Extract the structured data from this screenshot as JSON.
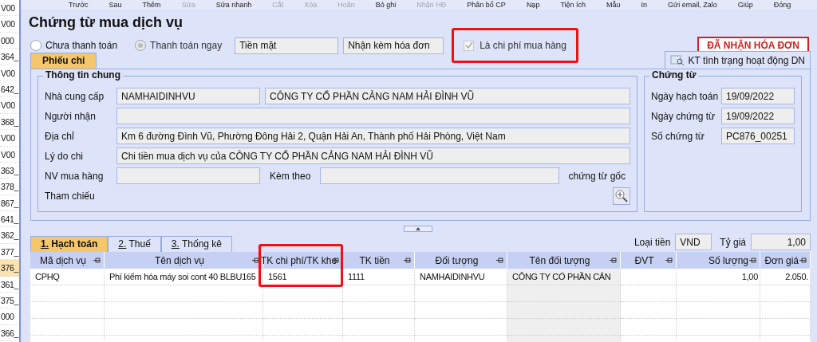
{
  "side_list": {
    "items": [
      {
        "label": "V00",
        "selected": false
      },
      {
        "label": "V00",
        "selected": false
      },
      {
        "label": "000",
        "selected": false
      },
      {
        "label": "364_",
        "selected": false
      },
      {
        "label": "V00",
        "selected": false
      },
      {
        "label": "642_",
        "selected": false
      },
      {
        "label": "V00",
        "selected": false
      },
      {
        "label": "368_",
        "selected": false
      },
      {
        "label": "V00",
        "selected": false
      },
      {
        "label": "V00",
        "selected": false
      },
      {
        "label": "363_",
        "selected": false
      },
      {
        "label": "378_",
        "selected": false
      },
      {
        "label": "867_",
        "selected": false
      },
      {
        "label": "641_",
        "selected": false
      },
      {
        "label": "362_",
        "selected": false
      },
      {
        "label": "377_",
        "selected": false
      },
      {
        "label": "376_",
        "selected": true
      },
      {
        "label": "361_",
        "selected": false
      },
      {
        "label": "375_",
        "selected": false
      },
      {
        "label": "000",
        "selected": false
      },
      {
        "label": "366_",
        "selected": false
      }
    ]
  },
  "toolbar": [
    {
      "label": "Trước",
      "disabled": false
    },
    {
      "label": "Sau",
      "disabled": false
    },
    {
      "label": "Thêm",
      "disabled": false
    },
    {
      "label": "Sửa",
      "disabled": true
    },
    {
      "label": "Sửa nhanh",
      "disabled": false
    },
    {
      "label": "Cắt",
      "disabled": true
    },
    {
      "label": "Xóa",
      "disabled": true
    },
    {
      "label": "Hoãn",
      "disabled": true
    },
    {
      "label": "Bỏ ghi",
      "disabled": false
    },
    {
      "label": "Nhận HĐ",
      "disabled": true
    },
    {
      "label": "Phân bổ CP",
      "disabled": false
    },
    {
      "label": "Nạp",
      "disabled": false
    },
    {
      "label": "Tiện ích",
      "disabled": false
    },
    {
      "label": "Mẫu",
      "disabled": false
    },
    {
      "label": "In",
      "disabled": false
    },
    {
      "label": "Gửi email, Zalo",
      "disabled": false
    },
    {
      "label": "Giúp",
      "disabled": false
    },
    {
      "label": "Đóng",
      "disabled": false
    }
  ],
  "window": {
    "title": "Chứng từ mua dịch vụ"
  },
  "payment": {
    "options": [
      {
        "label": "Chưa thanh toán",
        "selected": false,
        "disabled": false
      },
      {
        "label": "Thanh toán ngay",
        "selected": true,
        "disabled": true
      }
    ],
    "method": "Tiền mặt",
    "invoice": "Nhận kèm hóa đơn",
    "purchase_cost": {
      "label": "Là chi phí mua hàng",
      "checked": true,
      "disabled": true,
      "highlighted": true
    },
    "stamp": "ĐÃ NHẬN HÓA ĐƠN"
  },
  "form_tabs": [
    {
      "label": "Phiếu chi",
      "selected": true
    }
  ],
  "check_button": "KT tình trạng hoạt động DN",
  "general": {
    "title": "Thông tin chung",
    "supplier": {
      "label": "Nhà cung cấp",
      "code": "NAMHAIDINHVU",
      "name": "CÔNG TY CỔ PHẦN CẢNG NAM HẢI ĐÌNH VŨ"
    },
    "receiver": {
      "label": "Người nhận"
    },
    "address": {
      "label": "Địa chỉ",
      "value": "Km 6 đường Đình Vũ, Phường Đông Hải 2, Quận Hải An, Thành phố Hải Phòng, Việt Nam"
    },
    "reason": {
      "label": "Lý do chi",
      "value": "Chi tiền mua dịch vụ của CÔNG TY CỔ PHẦN CẢNG NAM HẢI ĐÌNH VŨ"
    },
    "buyer": {
      "label": "NV mua hàng"
    },
    "attached": {
      "label": "Kèm theo",
      "suffix": "chứng từ gốc"
    },
    "reference": {
      "label": "Tham chiếu"
    }
  },
  "voucher": {
    "title": "Chứng từ",
    "rows": [
      {
        "label": "Ngày hạch toán",
        "value": "19/09/2022"
      },
      {
        "label": "Ngày chứng từ",
        "value": "19/09/2022"
      },
      {
        "label": "Số chứng từ",
        "value": "PC876_00251"
      }
    ]
  },
  "detail_tabs": [
    {
      "label": "1. Hạch toán",
      "selected": true
    },
    {
      "label": "2. Thuế",
      "selected": false
    },
    {
      "label": "3. Thống kê",
      "selected": false
    }
  ],
  "currency": {
    "label": "Loại tiền",
    "value": "VND",
    "rate_label": "Tỷ giá",
    "rate": "1,00"
  },
  "table": {
    "columns": [
      {
        "label": "Mã dịch vụ",
        "kind": "text",
        "readonly": false,
        "highlighted": false
      },
      {
        "label": "Tên dịch vụ",
        "kind": "text",
        "readonly": false,
        "highlighted": false
      },
      {
        "label": "TK chi phí/TK kho",
        "kind": "text",
        "readonly": false,
        "highlighted": true
      },
      {
        "label": "TK tiền",
        "kind": "text",
        "readonly": false,
        "highlighted": false
      },
      {
        "label": "Đối tượng",
        "kind": "text",
        "readonly": false,
        "highlighted": false
      },
      {
        "label": "Tên đối tượng",
        "kind": "text",
        "readonly": true,
        "highlighted": false
      },
      {
        "label": "ĐVT",
        "kind": "text",
        "readonly": false,
        "highlighted": false
      },
      {
        "label": "Số lượng",
        "kind": "number",
        "readonly": false,
        "highlighted": false
      },
      {
        "label": "Đơn giá",
        "kind": "number",
        "readonly": false,
        "highlighted": false
      }
    ],
    "rows": [
      [
        "CPHQ",
        "Phí kiểm hóa máy soi cont 40 BLBU165",
        "1561",
        "1111",
        "NAMHAIDINHVU",
        "CÔNG TY CỔ PHẦN CẢN",
        "",
        "1,00",
        "2.050."
      ]
    ]
  }
}
